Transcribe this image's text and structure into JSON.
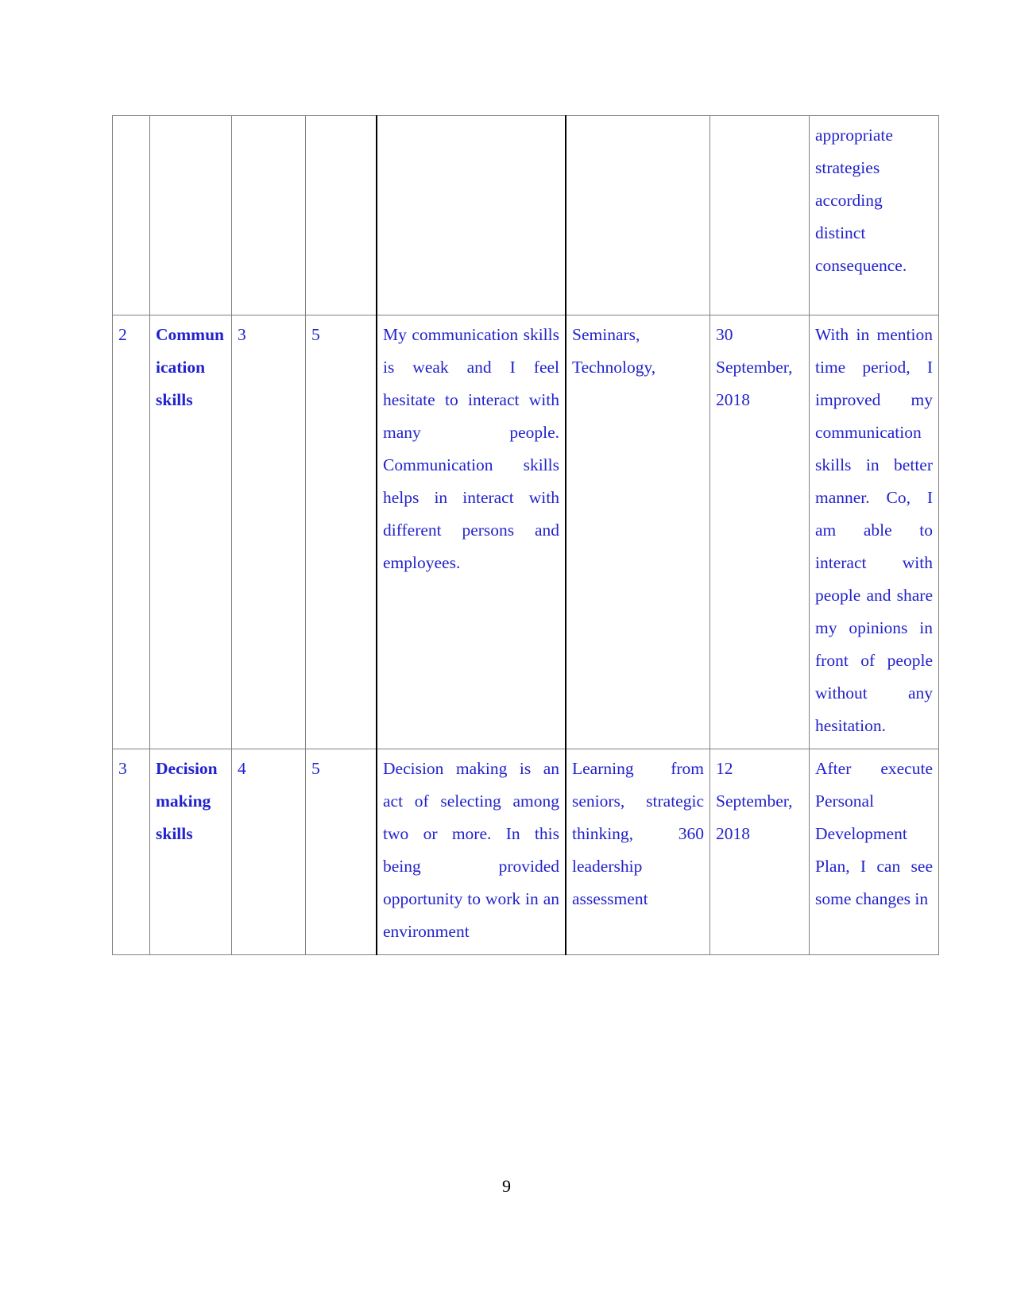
{
  "document": {
    "page_number": "9",
    "text_color": "#2222cc",
    "heading_color": "#000000",
    "table": {
      "rows": [
        {
          "id": "continuation-row",
          "num": "",
          "skill": "",
          "current": "",
          "target": "",
          "description": "",
          "resources": "",
          "date": "",
          "outcome": "appropriate strategies according distinct consequence."
        },
        {
          "id": "row-2-communication-skills",
          "num": "2",
          "skill": "Communication skills",
          "current": "3",
          "target": "5",
          "description": "My communication skills is weak and I feel hesitate to interact with many people. Communication skills helps in interact with different persons and employees.",
          "resources": "Seminars, Technology,",
          "date": "30 September, 2018",
          "outcome": "With in mention time period, I improved my communication skills in better manner. Co, I am able to interact with people and share my opinions in front of people without any hesitation."
        },
        {
          "id": "row-3-decision-making-skills",
          "num": "3",
          "skill": "Decision making skills",
          "current": "4",
          "target": "5",
          "description": "Decision making is an act of selecting among two or more. In this being provided opportunity to work in an environment",
          "resources": "Learning from seniors, strategic thinking, 360 leadership assessment",
          "date": "12 September, 2018",
          "outcome": "After execute Personal Development Plan, I can see some changes in"
        }
      ]
    }
  }
}
